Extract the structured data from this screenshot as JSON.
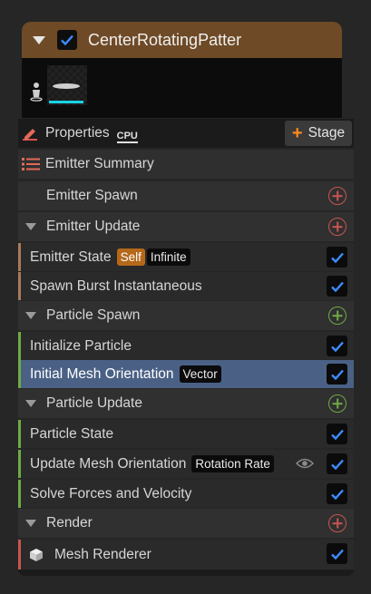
{
  "emitter": {
    "title": "CenterRotatingPatter",
    "enabled": true
  },
  "toolbar": {
    "properties_label": "Properties",
    "cpu_label": "CPU",
    "stage_label": "Stage",
    "stage_plus": "+"
  },
  "summary": {
    "label": "Emitter Summary"
  },
  "colors": {
    "accent_orange": "#6e4a26",
    "selected": "#4a6185",
    "check": "#3d8cff",
    "thumb_bar": "#19d3e6",
    "emitter_bar": "#a87a5a",
    "particle_bar": "#6faa45",
    "render_bar": "#c8564e"
  },
  "sections": {
    "emitter_spawn": "Emitter Spawn",
    "emitter_update": "Emitter Update",
    "particle_spawn": "Particle Spawn",
    "particle_update": "Particle Update",
    "render": "Render"
  },
  "modules": {
    "emitter_state": {
      "label": "Emitter State",
      "tag1": "Self",
      "tag2": "Infinite"
    },
    "spawn_burst": {
      "label": "Spawn Burst Instantaneous"
    },
    "initialize_particle": {
      "label": "Initialize Particle"
    },
    "initial_mesh_orientation": {
      "label": "Initial Mesh Orientation",
      "tag": "Vector"
    },
    "particle_state": {
      "label": "Particle State"
    },
    "update_mesh_orientation": {
      "label": "Update Mesh Orientation",
      "tag": "Rotation Rate"
    },
    "solve_forces": {
      "label": "Solve Forces and Velocity"
    },
    "mesh_renderer": {
      "label": "Mesh Renderer"
    }
  }
}
